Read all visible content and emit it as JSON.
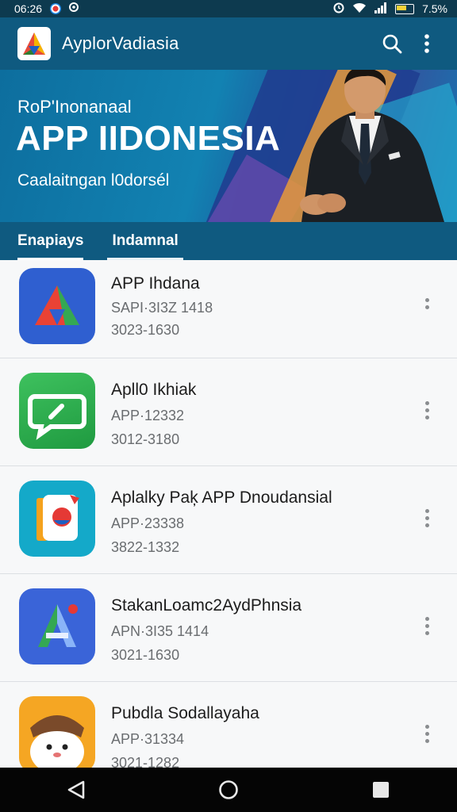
{
  "status_bar": {
    "time": "06:26",
    "battery_text": "7.5%",
    "icons": [
      "notification-icon",
      "location-icon",
      "alarm-icon",
      "wifi-icon",
      "signal-icon",
      "battery-icon"
    ]
  },
  "app_bar": {
    "title": "AyplorVadiasia",
    "logo_icon": "app-logo-icon",
    "actions": [
      "search-icon",
      "more-vert-icon"
    ]
  },
  "banner": {
    "kicker": "RoP'Inonanaal",
    "title": "APP IIDONESIA",
    "subtitle": "Caalaitngan l0dorsél"
  },
  "tabs": [
    {
      "label": "Enapiays",
      "active": true
    },
    {
      "label": "Indamnal",
      "active": false
    }
  ],
  "apps": [
    {
      "name": "APP Ihdana",
      "code": "SAPI·3I3Z 1418",
      "number": "3023-1630",
      "icon": "triangle-logo-icon"
    },
    {
      "name": "Apll0 Ikhiak",
      "code": "APP·12332",
      "number": "3012-3180",
      "icon": "chat-bubble-icon"
    },
    {
      "name": "Aplalky Paķ APP Dnoudansial",
      "code": "APP·23338",
      "number": "3822-1332",
      "icon": "maps-bookmark-icon"
    },
    {
      "name": "StakanLoamc2AydPhnsia",
      "code": "APN·3I35 1414",
      "number": "3021-1630",
      "icon": "navigation-a-icon"
    },
    {
      "name": "Pubdla Sodallayaha",
      "code": "APP·31334",
      "number": "3021-1282",
      "icon": "cartoon-character-icon"
    }
  ],
  "nav_bar": [
    "back-icon",
    "home-icon",
    "recents-icon"
  ],
  "colors": {
    "primary": "#0f5a80",
    "status_bar": "#0d3a4f",
    "nav_bar": "#050505"
  }
}
